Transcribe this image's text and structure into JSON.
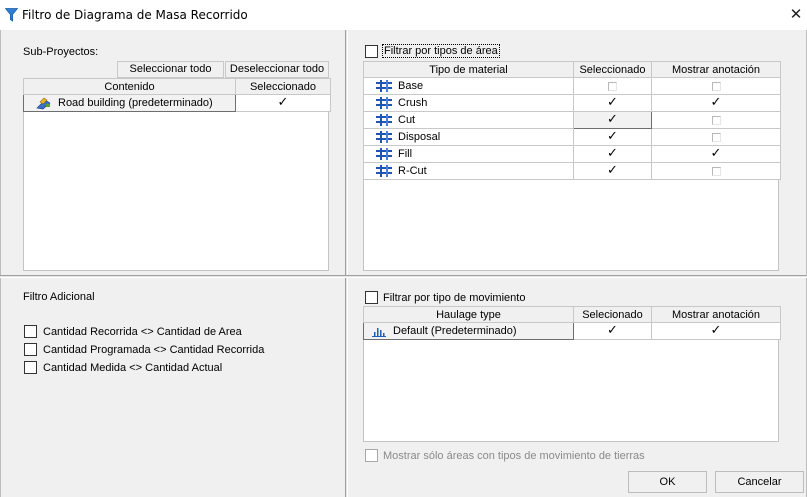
{
  "window": {
    "title": "Filtro de Diagrama de Masa Recorrido",
    "close_glyph": "✕"
  },
  "subprojects": {
    "label": "Sub-Proyectos:",
    "select_all": "Seleccionar todo",
    "deselect_all": "Deseleccionar todo",
    "columns": [
      "Contenido",
      "Seleccionado"
    ],
    "rows": [
      {
        "name": "Road building (predeterminado)",
        "icon": "road-building-icon",
        "selected": "✓"
      }
    ]
  },
  "area_filter": {
    "checkbox_label": "Filtrar por tipos de área",
    "checked": false,
    "columns": [
      "Tipo de material",
      "Seleccionado",
      "Mostrar anotación"
    ],
    "rows": [
      {
        "name": "Base",
        "icon": "material-icon",
        "selected": false,
        "annotate": false
      },
      {
        "name": "Crush",
        "icon": "material-icon",
        "selected": true,
        "annotate": true
      },
      {
        "name": "Cut",
        "icon": "material-icon",
        "selected": true,
        "annotate": false
      },
      {
        "name": "Disposal",
        "icon": "material-icon",
        "selected": true,
        "annotate": false
      },
      {
        "name": "Fill",
        "icon": "material-icon",
        "selected": true,
        "annotate": true
      },
      {
        "name": "R-Cut",
        "icon": "material-icon",
        "selected": true,
        "annotate": false
      }
    ],
    "check_glyph": "✓"
  },
  "additional_filter": {
    "label": "Filtro Adicional",
    "options": [
      {
        "label": "Cantidad Recorrida <> Cantidad de Area",
        "checked": false
      },
      {
        "label": "Cantidad Programada <> Cantidad Recorrida",
        "checked": false
      },
      {
        "label": "Cantidad Medida <> Cantidad Actual",
        "checked": false
      }
    ]
  },
  "movement_filter": {
    "checkbox_label": "Filtrar por tipo de movimiento",
    "checked": false,
    "columns": [
      "Haulage type",
      "Selecionado",
      "Mostrar anotación"
    ],
    "rows": [
      {
        "name": "Default (Predeterminado)",
        "icon": "haulage-chart-icon",
        "selected": "✓",
        "annotate": "✓"
      }
    ],
    "only_areas_label": "Mostrar sólo áreas con tipos de movimiento de tierras",
    "only_areas_checked": false
  },
  "buttons": {
    "ok": "OK",
    "cancel": "Cancelar"
  }
}
